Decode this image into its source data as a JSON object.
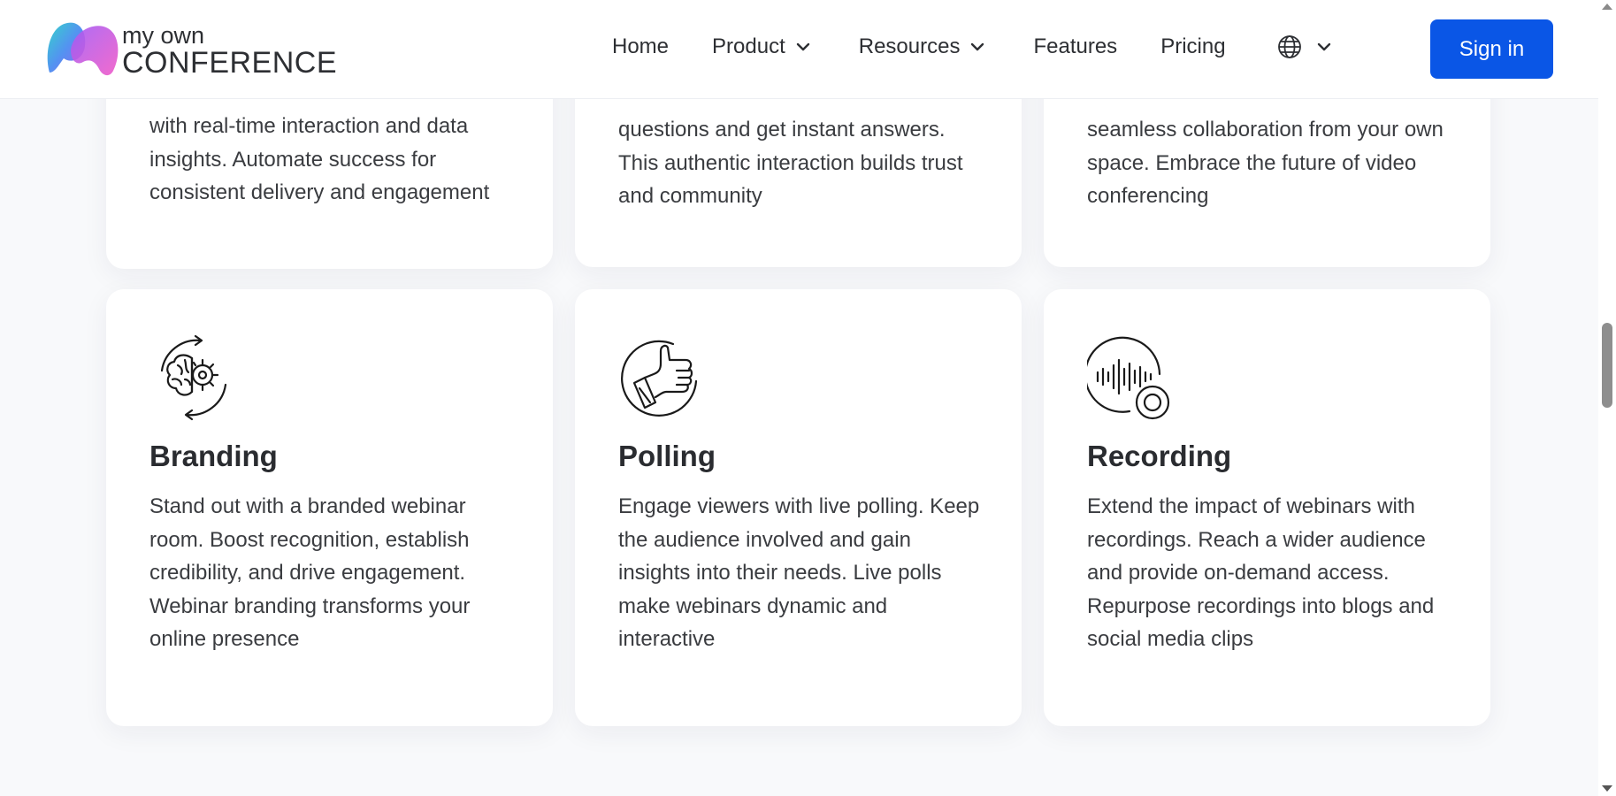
{
  "header": {
    "logo": {
      "line1": "my own",
      "line2": "CONFERENCE",
      "icon": "logo-icon"
    },
    "nav": {
      "home": "Home",
      "product": "Product",
      "resources": "Resources",
      "features": "Features",
      "pricing": "Pricing",
      "language_icon": "globe-icon"
    },
    "signin_label": "Sign in"
  },
  "colors": {
    "accent": "#0a56e6",
    "page_bg": "#f8f9fb",
    "card_bg": "#ffffff",
    "text": "#3a3c40"
  },
  "cards_top": [
    {
      "text": "with real-time interaction and data insights. Automate success for consistent delivery and engagement"
    },
    {
      "text": "questions and get instant answers. This authentic interaction builds trust and community"
    },
    {
      "text": "seamless collaboration from your own space. Embrace the future of video conferencing"
    }
  ],
  "cards": [
    {
      "icon": "brain-gear-icon",
      "title": "Branding",
      "text": "Stand out with a branded webinar room. Boost recognition, establish credibility, and drive engagement. Webinar branding transforms your online presence"
    },
    {
      "icon": "thumbs-up-icon",
      "title": "Polling",
      "text": "Engage viewers with live polling. Keep the audience involved and gain insights into their needs. Live polls make webinars dynamic and interactive"
    },
    {
      "icon": "recording-icon",
      "title": "Recording",
      "text": "Extend the impact of webinars with recordings. Reach a wider audience and provide on-demand access. Repurpose recordings into blogs and social media clips"
    }
  ]
}
